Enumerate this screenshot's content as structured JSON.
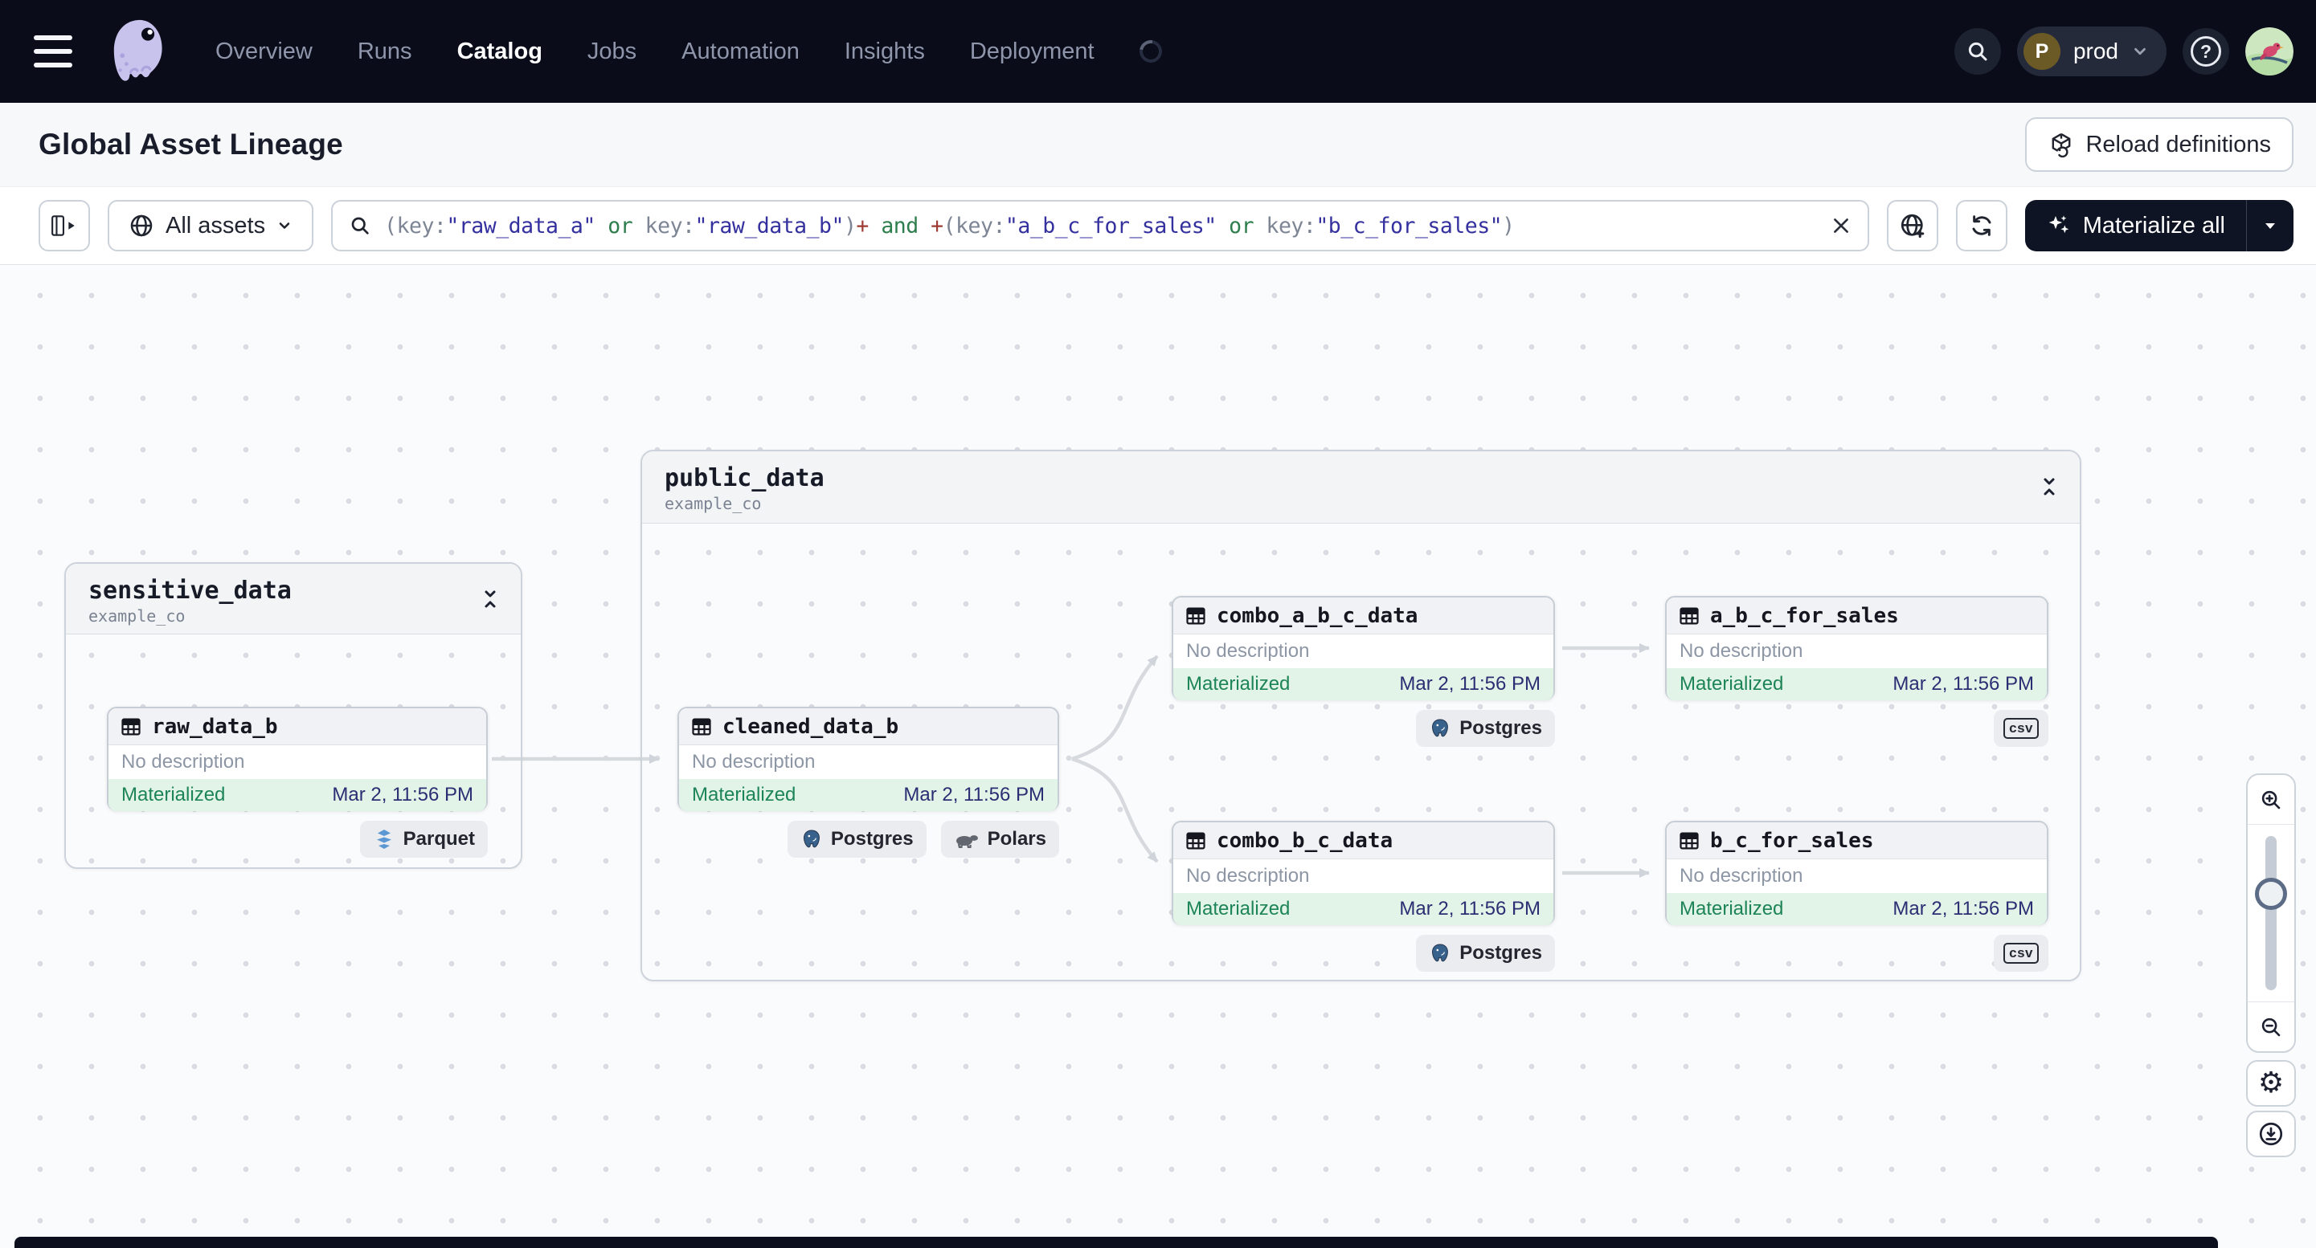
{
  "nav": {
    "links": [
      "Overview",
      "Runs",
      "Catalog",
      "Jobs",
      "Automation",
      "Insights",
      "Deployment"
    ],
    "active_link": "Catalog",
    "workspace": {
      "avatar_initial": "P",
      "name": "prod"
    }
  },
  "header": {
    "title": "Global Asset Lineage",
    "reload_label": "Reload definitions"
  },
  "toolbar": {
    "scope_label": "All assets",
    "materialize_label": "Materialize all",
    "query": {
      "text": "(key:\"raw_data_a\" or key:\"raw_data_b\")+ and +(key:\"a_b_c_for_sales\" or key:\"b_c_for_sales\")",
      "tokens": [
        {
          "type": "punc",
          "text": "(key:"
        },
        {
          "type": "str",
          "text": "\"raw_data_a\""
        },
        {
          "type": "kw",
          "text": " or "
        },
        {
          "type": "punc",
          "text": "key:"
        },
        {
          "type": "str",
          "text": "\"raw_data_b\""
        },
        {
          "type": "punc",
          "text": ")"
        },
        {
          "type": "plus",
          "text": "+"
        },
        {
          "type": "kw",
          "text": " and "
        },
        {
          "type": "plus",
          "text": "+"
        },
        {
          "type": "punc",
          "text": "(key:"
        },
        {
          "type": "str",
          "text": "\"a_b_c_for_sales\""
        },
        {
          "type": "kw",
          "text": " or "
        },
        {
          "type": "punc",
          "text": "key:"
        },
        {
          "type": "str",
          "text": "\"b_c_for_sales\""
        },
        {
          "type": "punc",
          "text": ")"
        }
      ]
    }
  },
  "graph": {
    "groups": [
      {
        "name": "sensitive_data",
        "location": "example_co"
      },
      {
        "name": "public_data",
        "location": "example_co"
      }
    ],
    "nodes": [
      {
        "name": "raw_data_b",
        "description": "No description",
        "status": "Materialized",
        "timestamp": "Mar 2, 11:56 PM",
        "badges": [
          {
            "label": "Parquet",
            "icon": "parquet-icon"
          }
        ]
      },
      {
        "name": "cleaned_data_b",
        "description": "No description",
        "status": "Materialized",
        "timestamp": "Mar 2, 11:56 PM",
        "badges": [
          {
            "label": "Postgres",
            "icon": "postgres-icon"
          },
          {
            "label": "Polars",
            "icon": "polars-icon"
          }
        ]
      },
      {
        "name": "combo_a_b_c_data",
        "description": "No description",
        "status": "Materialized",
        "timestamp": "Mar 2, 11:56 PM",
        "badges": [
          {
            "label": "Postgres",
            "icon": "postgres-icon"
          }
        ]
      },
      {
        "name": "a_b_c_for_sales",
        "description": "No description",
        "status": "Materialized",
        "timestamp": "Mar 2, 11:56 PM",
        "badges": [
          {
            "label": "csv",
            "icon": "csv-icon"
          }
        ]
      },
      {
        "name": "combo_b_c_data",
        "description": "No description",
        "status": "Materialized",
        "timestamp": "Mar 2, 11:56 PM",
        "badges": [
          {
            "label": "Postgres",
            "icon": "postgres-icon"
          }
        ]
      },
      {
        "name": "b_c_for_sales",
        "description": "No description",
        "status": "Materialized",
        "timestamp": "Mar 2, 11:56 PM",
        "badges": [
          {
            "label": "csv",
            "icon": "csv-icon"
          }
        ]
      }
    ]
  },
  "icons": [
    "hamburger-icon",
    "dagster-logo",
    "search-icon",
    "chevron-down-icon",
    "help-icon",
    "user-avatar",
    "spinner",
    "panel-toggle-icon",
    "globe-icon",
    "magnifier-icon",
    "clear-icon",
    "globe-add-icon",
    "refresh-icon",
    "sparkles-icon",
    "reload-cube-icon",
    "table-icon",
    "collapse-icon",
    "arrow-edge",
    "zoom-in-icon",
    "zoom-out-icon",
    "gear-icon",
    "download-icon",
    "postgres-icon",
    "polars-icon",
    "parquet-icon",
    "csv-icon"
  ],
  "colors": {
    "nav_bg": "#0a0d19",
    "accent_dark": "#0e1424",
    "status_green": "#1d8457",
    "status_bg": "#e2f4e8",
    "timestamp_navy": "#2b2e72",
    "query_string": "#34309e",
    "query_keyword": "#2e7d4c",
    "query_plus": "#9e3a32"
  }
}
